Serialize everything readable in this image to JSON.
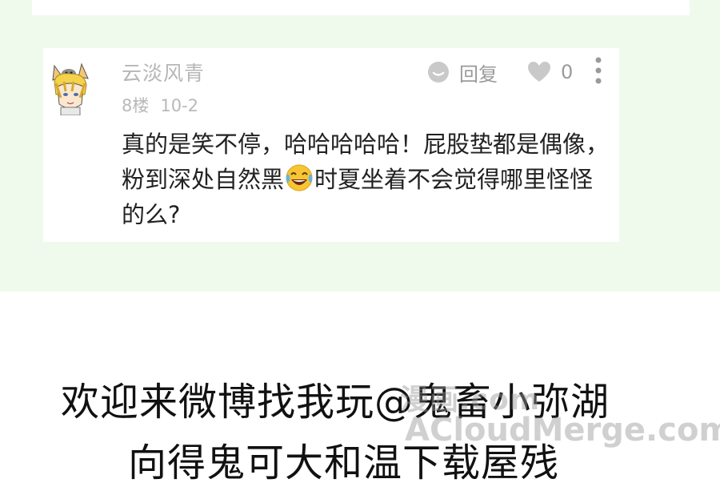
{
  "comment": {
    "username": "云淡风青",
    "floor": "8楼",
    "date": "10-2",
    "reply_label": "回复",
    "like_count": "0",
    "text_part1": "真的是笑不停，哈哈哈哈哈！屁股垫都是偶像，粉到深处自然黑",
    "text_part2": "时夏坐着不会觉得哪里怪怪的么?",
    "icons": {
      "reply": "chat-bubble-icon",
      "like": "heart-icon",
      "more": "more-vertical-icon",
      "emoji": "laughing-tears-emoji-icon",
      "avatar": "anime-cat-ear-avatar"
    }
  },
  "footer": {
    "line1": "欢迎来微博找我玩@鬼畜小弥湖",
    "line2": "向得鬼可大和温下载屋残"
  },
  "watermark": {
    "line1": "漫画.com",
    "line2": "ACloudMerge.com"
  },
  "colors": {
    "page_background": "#effaec",
    "card_background": "#ffffff",
    "muted_text": "#b7b7b7",
    "body_text": "#222222"
  }
}
